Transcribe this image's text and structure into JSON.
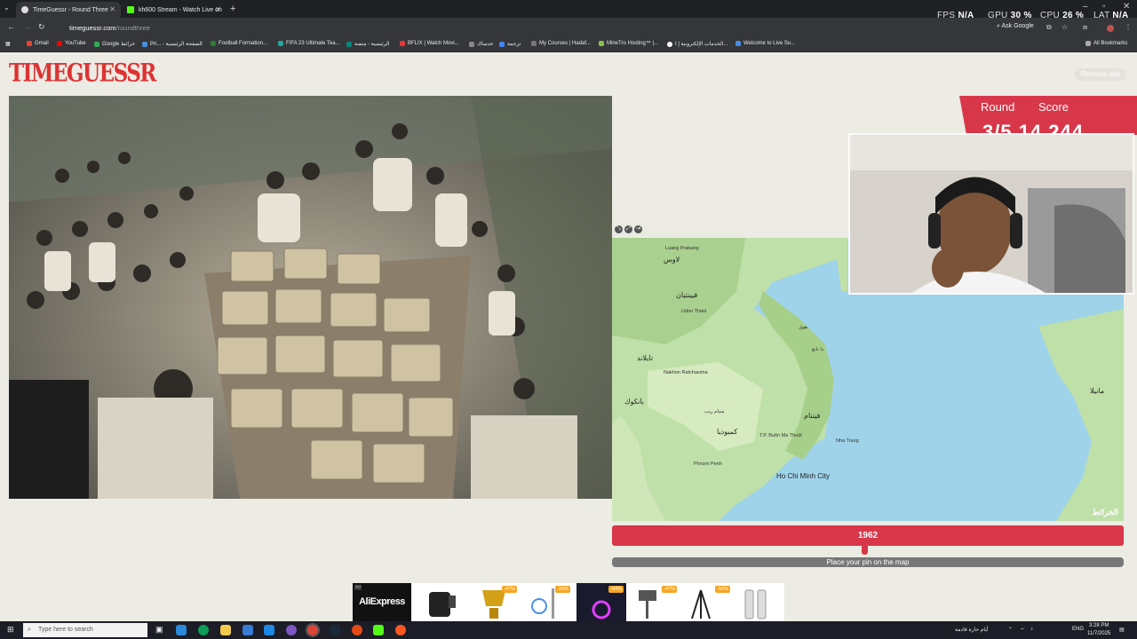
{
  "browser": {
    "tabs": [
      {
        "title": "TimeGuessr - Round Three",
        "active": true
      },
      {
        "title": "kh600 Stream - Watch Live on",
        "active": false
      }
    ],
    "url_host": "timeguessr.com",
    "url_path": "/roundthree",
    "ask_google": "Ask Google",
    "all_bookmarks": "All Bookmarks",
    "bookmarks": [
      "Gmail",
      "YouTube",
      "Google خرائط",
      "Pri... - الصفحة الرئيسية",
      "Football Formation...",
      "FIFA 23 Ultimate Tea...",
      "الرئيسية - منصة",
      "BFLIX | Watch Movi...",
      "عدساك",
      "ترجمة",
      "My Courses | Hadaf...",
      "MineTro Hosting™ |...",
      "الخدمات الإلكترونية | ا...",
      "Welcome to Live Su..."
    ]
  },
  "hud": {
    "fps_label": "FPS",
    "fps_value": "N/A",
    "gpu_label": "GPU",
    "gpu_value": "30 %",
    "cpu_label": "CPU",
    "cpu_value": "26 %",
    "lat_label": "LAT",
    "lat_value": "N/A"
  },
  "page": {
    "logo": "TIMEGUESSR",
    "remove_ads": "Remove ads",
    "round_label": "Round",
    "score_label": "Score",
    "score_value": "3/5 14,244",
    "year": "1962",
    "year_fraction": 0.5,
    "pin_prompt": "Place your pin on the map",
    "map_brand": "الخرائط",
    "map_labels": {
      "luang": "Luang Prabang",
      "laos": "لاوس",
      "vientiane": "فيينتيان",
      "udon": "Udon Thani",
      "hue": "هوي",
      "thailand": "تايلاند",
      "nakhon": "Nakhon Ratchasima",
      "bangkok": "بانكوك",
      "cambodia": "كمبوديا",
      "vietnam": "فيتنام",
      "phnom": "Phnom Penh",
      "hcmc": "Ho Chi Minh City",
      "nhatrang": "Nha Trang",
      "danang": "دا نانغ",
      "manila": "مانيلا",
      "siemreap": "سيام ريب",
      "tpbuon": "T.P. Buôn Ma Thuột"
    }
  },
  "ad": {
    "brand": "AliExpress",
    "tag": "Ad",
    "discounts": [
      "-47%",
      "-28%",
      "-54%",
      "-47%",
      "-56%"
    ]
  },
  "taskbar": {
    "search_placeholder": "Type here to search",
    "lang": "ENG",
    "time": "3:28 PM",
    "date": "11/7/2025",
    "weather": "أيام حارة قادمة"
  }
}
